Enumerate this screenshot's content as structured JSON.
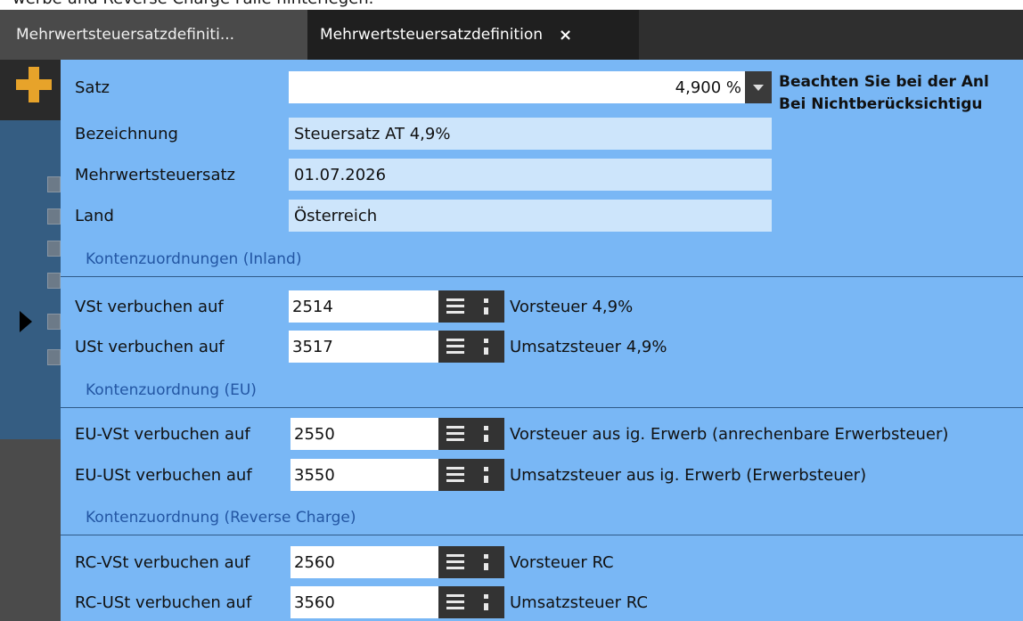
{
  "top_text": "werbe und Reverse Charge Fälle hinterlegen.",
  "tabs": [
    {
      "label": "Mehrwertsteuersatzdefiniti..."
    },
    {
      "label": "Mehrwertsteuersatzdefinition",
      "close": "×"
    }
  ],
  "form": {
    "satz": {
      "label": "Satz",
      "value": "4,900 %"
    },
    "bezeichnung": {
      "label": "Bezeichnung",
      "value": "Steuersatz AT 4,9%"
    },
    "mehrwertsteuersatz": {
      "label": "Mehrwertsteuersatz",
      "value": "01.07.2026"
    },
    "land": {
      "label": "Land",
      "value": "Österreich"
    }
  },
  "note": {
    "line1": "Beachten Sie bei der Anl",
    "line2": "Bei Nichtberücksichtigu"
  },
  "sections": {
    "inland": "Kontenzuordnungen (Inland)",
    "eu": "Kontenzuordnung (EU)",
    "rc": "Kontenzuordnung (Reverse Charge)"
  },
  "accounts": {
    "vst": {
      "label": "VSt verbuchen auf",
      "number": "2514",
      "description": "Vorsteuer 4,9%"
    },
    "ust": {
      "label": "USt verbuchen auf",
      "number": "3517",
      "description": "Umsatzsteuer 4,9%"
    },
    "eu_vst": {
      "label": "EU-VSt verbuchen auf",
      "number": "2550",
      "description": "Vorsteuer aus ig. Erwerb (anrechenbare Erwerbsteuer)"
    },
    "eu_ust": {
      "label": "EU-USt verbuchen auf",
      "number": "3550",
      "description": "Umsatzsteuer aus ig. Erwerb (Erwerbsteuer)"
    },
    "rc_vst": {
      "label": "RC-VSt verbuchen auf",
      "number": "2560",
      "description": "Vorsteuer RC"
    },
    "rc_ust": {
      "label": "RC-USt verbuchen auf",
      "number": "3560",
      "description": "Umsatzsteuer RC"
    }
  },
  "icons": {
    "add": "plus-icon",
    "dropdown": "chevron-down-icon",
    "list": "list-icon",
    "more": "more-vertical-icon",
    "row_marker": "row-pointer-icon"
  },
  "colors": {
    "panel": "#79b7f5",
    "readonly_field": "#cde5fb",
    "section_text": "#2356a3",
    "accent_plus": "#e7a32a",
    "tabbar": "#2f2f2f"
  }
}
